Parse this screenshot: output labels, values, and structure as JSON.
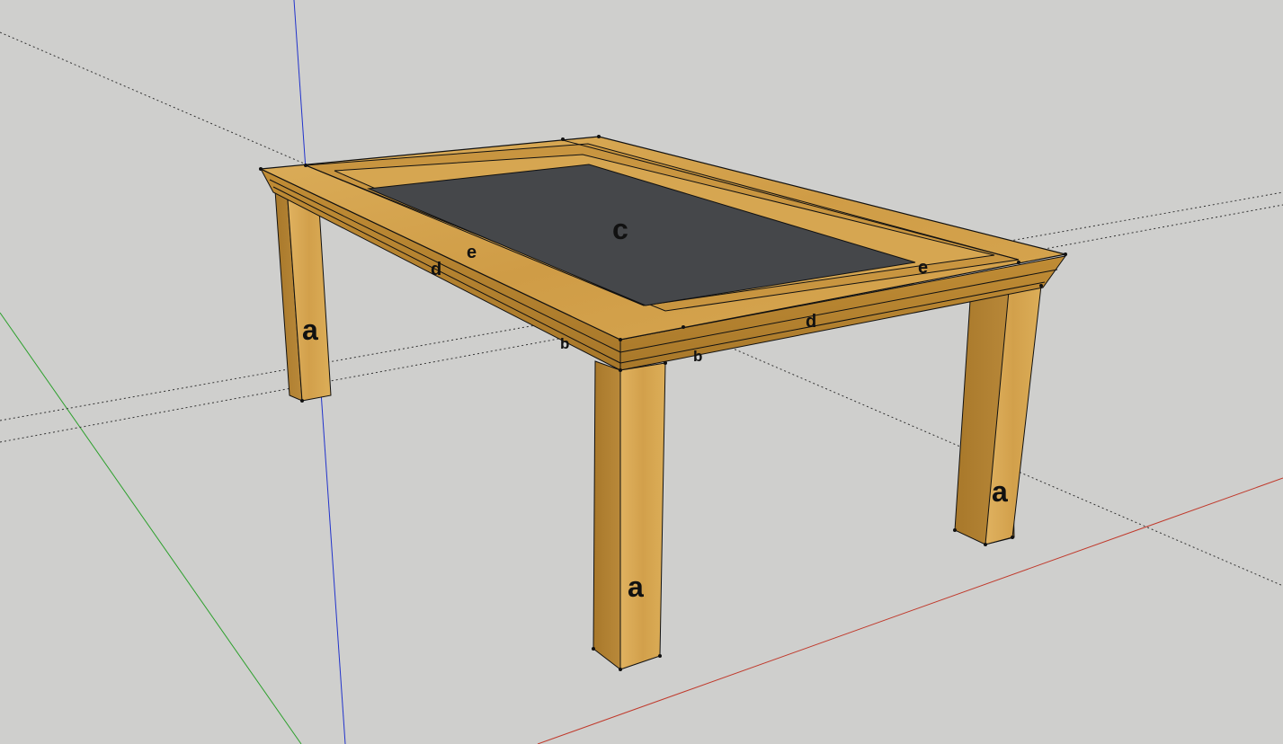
{
  "viewport": {
    "background": "#cfcfcd",
    "axes": {
      "red": "#c0392b",
      "green": "#2ca02c",
      "blue": "#2233cc",
      "inference": "#333333"
    }
  },
  "materials": {
    "wood_top": "#d4a24c",
    "wood_side": "#b8862f",
    "wood_dark": "#9a6b1f",
    "panel": "#45474a",
    "edge": "#111111"
  },
  "labels": {
    "leg_front": "a",
    "leg_back_left": "a",
    "leg_right": "a",
    "apron_b_left": "b",
    "apron_b_right": "b",
    "panel_c": "c",
    "rail_d_left": "d",
    "rail_d_right": "d",
    "frame_e_left": "e",
    "frame_e_right": "e"
  }
}
